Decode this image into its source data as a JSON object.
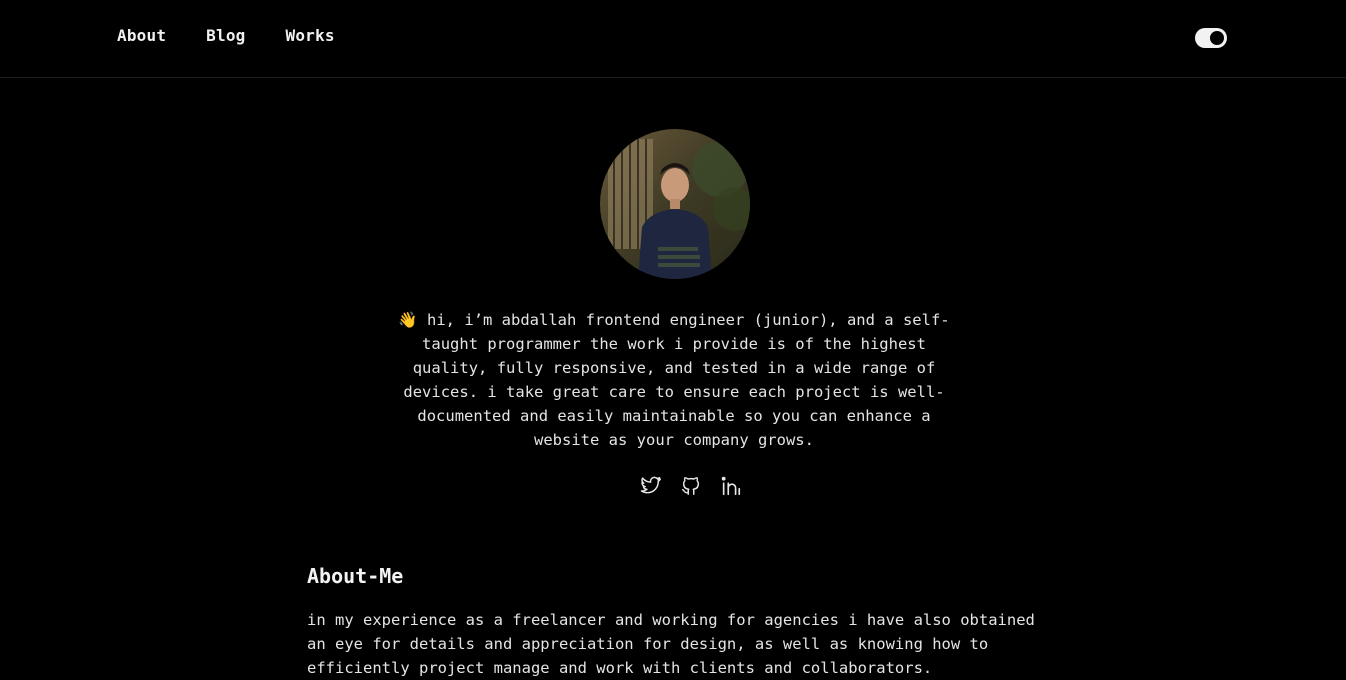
{
  "nav": {
    "about": "About",
    "blog": "Blog",
    "works": "Works"
  },
  "theme_toggle": {
    "state": "dark",
    "icon": "toggle-switch"
  },
  "profile": {
    "avatar_icon": "profile-photo"
  },
  "intro": {
    "text": "👋 hi, i’m abdallah frontend engineer (junior), and a self-taught programmer the work i provide is of the highest quality, fully responsive, and tested in a wide range of devices. i take great care to ensure each project is well-documented and easily maintainable so you can enhance a website as your company grows."
  },
  "socials": [
    {
      "icon": "twitter-icon"
    },
    {
      "icon": "github-icon"
    },
    {
      "icon": "linkedin-icon"
    }
  ],
  "about_me": {
    "title": "About-Me",
    "text": "in my experience as a freelancer and working for agencies i have also obtained an eye for details and appreciation for design, as well as knowing how to efficiently project manage and work with clients and collaborators."
  },
  "colors": {
    "background": "#000000",
    "text": "#e6e6e6",
    "toggle": "#f2f2f2"
  }
}
